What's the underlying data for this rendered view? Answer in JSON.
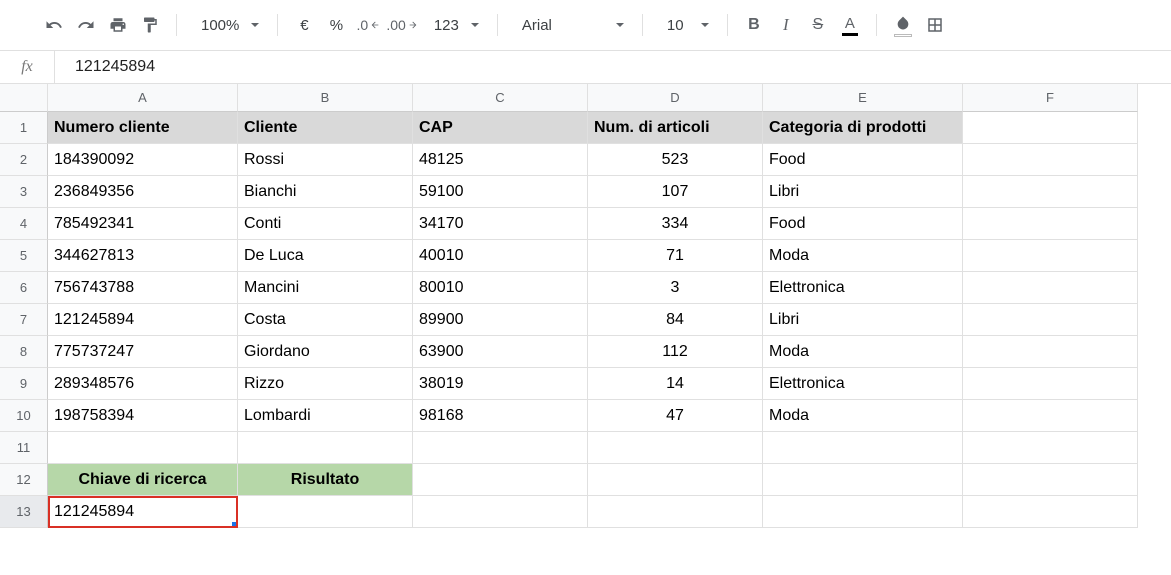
{
  "toolbar": {
    "zoom": "100%",
    "font": "Arial",
    "fontSize": "10",
    "currency": "€",
    "percent": "%",
    "decDecrease": ".0",
    "decIncrease": ".00",
    "numFormat": "123",
    "bold": "B",
    "italic": "I",
    "strike": "S",
    "textColor": "A"
  },
  "formulaBar": {
    "fx": "fx",
    "value": "121245894"
  },
  "columns": [
    "A",
    "B",
    "C",
    "D",
    "E",
    "F"
  ],
  "headerRow": {
    "A": "Numero cliente",
    "B": "Cliente",
    "C": "CAP",
    "D": "Num. di articoli",
    "E": "Categoria di prodotti"
  },
  "rows": [
    {
      "A": "184390092",
      "B": "Rossi",
      "C": "48125",
      "D": "523",
      "E": "Food"
    },
    {
      "A": "236849356",
      "B": "Bianchi",
      "C": "59100",
      "D": "107",
      "E": "Libri"
    },
    {
      "A": "785492341",
      "B": "Conti",
      "C": "34170",
      "D": "334",
      "E": "Food"
    },
    {
      "A": "344627813",
      "B": "De Luca",
      "C": "40010",
      "D": "71",
      "E": "Moda"
    },
    {
      "A": "756743788",
      "B": "Mancini",
      "C": "80010",
      "D": "3",
      "E": "Elettronica"
    },
    {
      "A": "121245894",
      "B": "Costa",
      "C": "89900",
      "D": "84",
      "E": "Libri"
    },
    {
      "A": "775737247",
      "B": "Giordano",
      "C": "63900",
      "D": "112",
      "E": "Moda"
    },
    {
      "A": "289348576",
      "B": "Rizzo",
      "C": "38019",
      "D": "14",
      "E": "Elettronica"
    },
    {
      "A": "198758394",
      "B": "Lombardi",
      "C": "98168",
      "D": "47",
      "E": "Moda"
    }
  ],
  "searchRow": {
    "A": "Chiave di ricerca",
    "B": "Risultato"
  },
  "selectedCell": "121245894",
  "rowNumbers": [
    "1",
    "2",
    "3",
    "4",
    "5",
    "6",
    "7",
    "8",
    "9",
    "10",
    "11",
    "12",
    "13"
  ]
}
